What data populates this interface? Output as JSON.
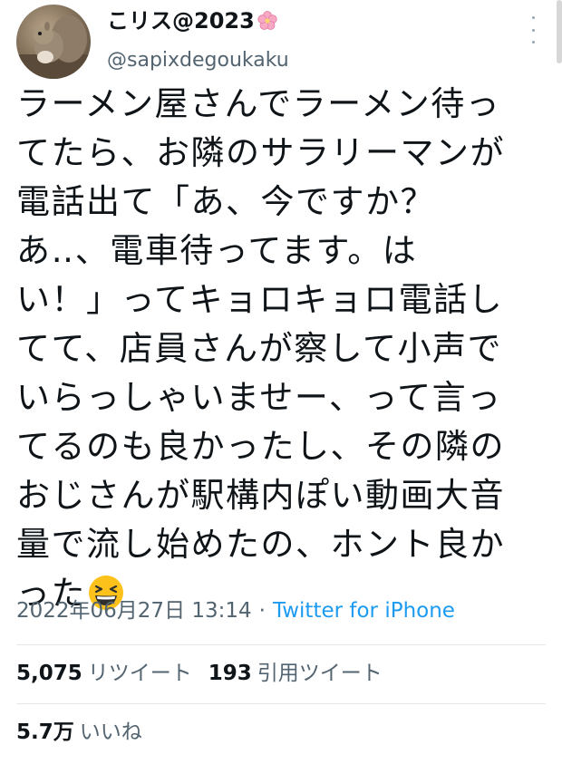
{
  "author": {
    "display_name": "こリス@2023",
    "handle": "@sapixdegoukaku",
    "name_emoji": "cherry-blossom-icon"
  },
  "tweet": {
    "lines": [
      "ラーメン屋さんでラーメン待っ",
      "てたら、お隣のサラリーマンが",
      "電話出て「あ、今ですか？",
      "あ‥、電車待ってます。は",
      "い！」ってキョロキョロ電話し",
      "てて、店員さんが察して小声で",
      "いらっしゃいませー、って言っ",
      "てるのも良かったし、その隣の",
      "おじさんが駅構内ぽい動画大音",
      "量で流し始めたの、ホント良か",
      "った"
    ],
    "trailing_emoji": "grinning-squinting-face-icon"
  },
  "meta": {
    "timestamp": "2022年06月27日 13:14",
    "separator": "·",
    "source": "Twitter for iPhone"
  },
  "stats": {
    "retweets_count": "5,075",
    "retweets_label": "リツイート",
    "quotes_count": "193",
    "quotes_label": "引用ツイート",
    "likes_count": "5.7万",
    "likes_label": "いいね"
  },
  "colors": {
    "text": "#0f1419",
    "secondary": "#536471",
    "link": "#1d9bf0",
    "divider": "#e4e8eb"
  }
}
